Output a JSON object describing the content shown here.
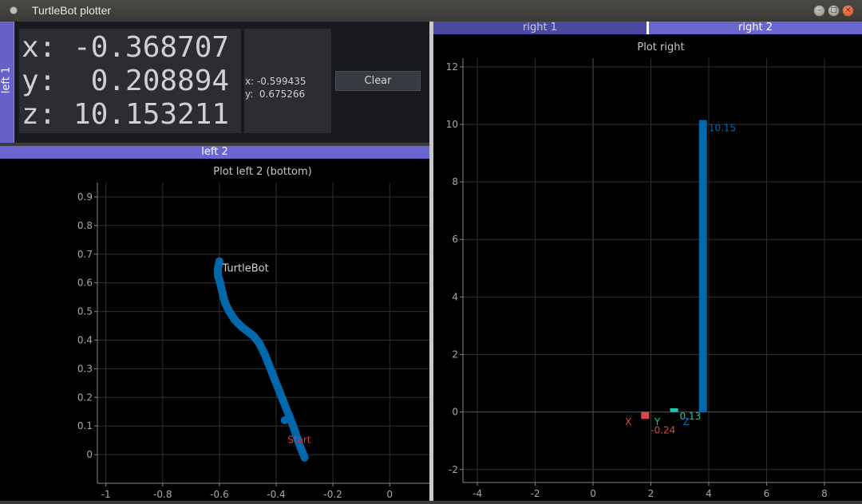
{
  "window": {
    "title": "TurtleBot plotter"
  },
  "left1": {
    "tab_label": "left 1",
    "x_line": "x: -0.368707",
    "y_line": "y:  0.208894",
    "z_line": "z: 10.153211",
    "mouse_x": "x: -0.599435",
    "mouse_y": "y:  0.675266",
    "clear_label": "Clear"
  },
  "left2": {
    "tab_label": "left 2",
    "plot_title": "Plot left 2 (bottom)",
    "x_ticks": [
      "-1",
      "-0.8",
      "-0.6",
      "-0.4",
      "-0.2",
      "0"
    ],
    "y_ticks": [
      "0",
      "0.1",
      "0.2",
      "0.3",
      "0.4",
      "0.5",
      "0.6",
      "0.7",
      "0.8",
      "0.9"
    ],
    "robot_label": "TurtleBot",
    "start_label": "Start"
  },
  "right": {
    "tabs": [
      "right 1",
      "right 2"
    ],
    "plot_title": "Plot right",
    "x_ticks": [
      "-4",
      "-2",
      "0",
      "2",
      "4",
      "6",
      "8"
    ],
    "y_ticks": [
      "-2",
      "0",
      "2",
      "4",
      "6",
      "8",
      "10",
      "12"
    ],
    "bar_labels": {
      "x": "X",
      "y": "Y",
      "z": "Z"
    },
    "value_labels": {
      "x": "-0.24",
      "y": "0.13",
      "z": "10.15"
    }
  },
  "colors": {
    "trajectory": "#0068ab",
    "start": "#d83a3a",
    "bar_x": "#d84a48",
    "bar_y": "#1fc8a2",
    "bar_z": "#0069ad"
  },
  "chart_data": [
    {
      "type": "line",
      "title": "Plot left 2 (bottom)",
      "xlim": [
        -1.03,
        0.14
      ],
      "ylim": [
        -0.1,
        0.95
      ],
      "grid": true,
      "series": [
        {
          "x": [
            -0.3,
            -0.32,
            -0.34,
            -0.36,
            -0.38,
            -0.4,
            -0.42,
            -0.44,
            -0.46,
            -0.48,
            -0.5,
            -0.52,
            -0.545,
            -0.565,
            -0.58,
            -0.588,
            -0.595,
            -0.6,
            -0.605,
            -0.605,
            -0.6
          ],
          "y": [
            -0.01,
            0.04,
            0.1,
            0.15,
            0.2,
            0.25,
            0.3,
            0.35,
            0.39,
            0.415,
            0.43,
            0.445,
            0.47,
            0.5,
            0.53,
            0.56,
            0.59,
            0.61,
            0.625,
            0.65,
            0.675
          ]
        }
      ],
      "annotations": [
        {
          "text": "TurtleBot",
          "x": -0.59,
          "y": 0.64
        },
        {
          "text": "Start",
          "x": -0.36,
          "y": 0.08
        }
      ],
      "markers": [
        {
          "x": -0.37,
          "y": 0.12
        },
        {
          "x": -0.3,
          "y": -0.01
        }
      ]
    },
    {
      "type": "bar",
      "title": "Plot right",
      "xlim": [
        -4.5,
        9.3
      ],
      "ylim": [
        -2.45,
        12.3
      ],
      "grid": true,
      "categories": [
        "X",
        "Y",
        "Z"
      ],
      "positions": [
        1.8,
        2.8,
        3.8
      ],
      "values": [
        -0.24,
        0.13,
        10.15
      ]
    }
  ]
}
